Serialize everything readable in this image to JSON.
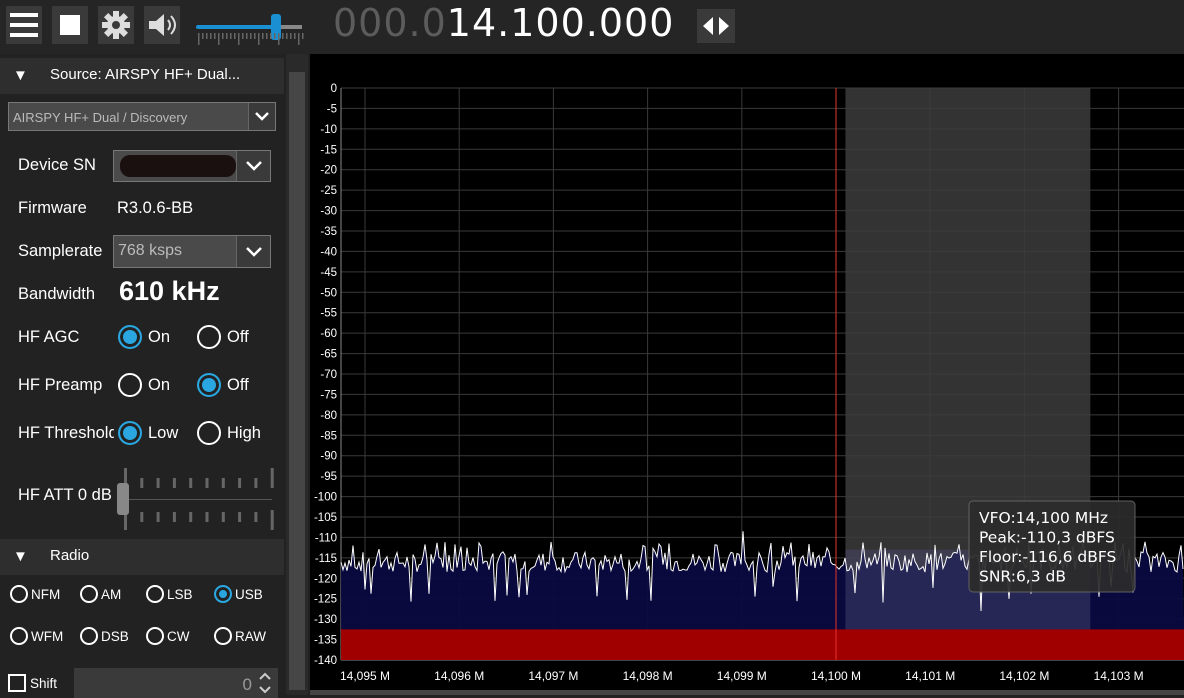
{
  "toolbar": {
    "menu_icon": "hamburger-icon",
    "stop_icon": "stop-icon",
    "settings_icon": "gear-icon",
    "volume_icon": "speaker-icon",
    "volume_level": 0.8,
    "frequency_dim": "000.0",
    "frequency_lit": "14.100.000",
    "tune_icon": "left-right-arrows-icon"
  },
  "source": {
    "header": "Source: AIRSPY HF+ Dual...",
    "device_select": "AIRSPY HF+ Dual / Discovery",
    "device_sn_label": "Device SN",
    "firmware_label": "Firmware",
    "firmware_value": "R3.0.6-BB",
    "samplerate_label": "Samplerate",
    "samplerate_value": "768 ksps",
    "bandwidth_label": "Bandwidth",
    "bandwidth_value": "610 kHz",
    "hf_agc_label": "HF AGC",
    "hf_agc_on": "On",
    "hf_agc_off": "Off",
    "hf_preamp_label": "HF Preamp",
    "hf_preamp_on": "On",
    "hf_preamp_off": "Off",
    "hf_threshold_label": "HF Threshold",
    "hf_threshold_low": "Low",
    "hf_threshold_high": "High",
    "hf_att_label": "HF ATT 0 dB",
    "hf_att_level": 0
  },
  "radio": {
    "header": "Radio",
    "modes": [
      "NFM",
      "AM",
      "LSB",
      "USB",
      "WFM",
      "DSB",
      "CW",
      "RAW"
    ],
    "selected_mode": "USB",
    "shift_label": "Shift",
    "shift_value": "0"
  },
  "spectrum": {
    "y_ticks": [
      "0",
      "-5",
      "-10",
      "-15",
      "-20",
      "-25",
      "-30",
      "-35",
      "-40",
      "-45",
      "-50",
      "-55",
      "-60",
      "-65",
      "-70",
      "-75",
      "-80",
      "-85",
      "-90",
      "-95",
      "-100",
      "-105",
      "-110",
      "-115",
      "-120",
      "-125",
      "-130",
      "-135",
      "-140"
    ],
    "x_ticks": [
      "14,095 M",
      "14,096 M",
      "14,097 M",
      "14,098 M",
      "14,099 M",
      "14,100 M",
      "14,101 M",
      "14,102 M",
      "14,103 M"
    ],
    "tooltip": {
      "vfo": "VFO:14,100 MHz",
      "peak": "Peak:-110,3 dBFS",
      "floor": "Floor:-116,6 dBFS",
      "snr": "SNR:6,3 dB"
    },
    "colors": {
      "vfo_line": "#e8322a",
      "passband": "#3c3c3c",
      "noise_fill": "#0a0a40",
      "floor_band": "#a00000",
      "trace": "#ffffff",
      "accent": "#2aa7e0"
    }
  }
}
